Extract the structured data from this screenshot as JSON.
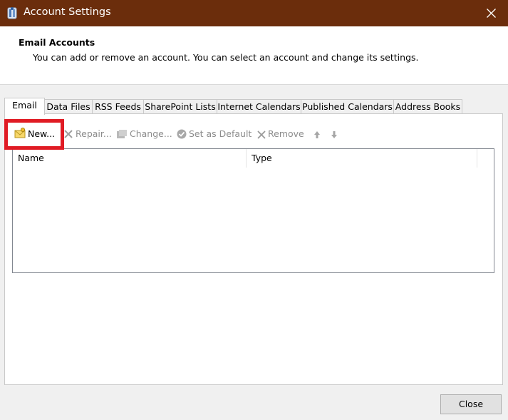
{
  "window": {
    "title": "Account Settings",
    "colors": {
      "titlebar": "#6b2d0c",
      "highlight": "#e01b24"
    },
    "title_icon": "outlook-account-icon",
    "close_icon": "close-icon"
  },
  "header": {
    "title": "Email Accounts",
    "description": "You can add or remove an account. You can select an account and change its settings."
  },
  "tabs": [
    {
      "label": "Email",
      "active": true
    },
    {
      "label": "Data Files"
    },
    {
      "label": "RSS Feeds"
    },
    {
      "label": "SharePoint Lists"
    },
    {
      "label": "Internet Calendars"
    },
    {
      "label": "Published Calendars"
    },
    {
      "label": "Address Books"
    }
  ],
  "toolbar": {
    "new_label": "New...",
    "repair_label": "Repair...",
    "change_label": "Change...",
    "set_default_label": "Set as Default",
    "remove_label": "Remove"
  },
  "list": {
    "columns": [
      "Name",
      "Type"
    ],
    "rows": []
  },
  "footer": {
    "close_label": "Close"
  }
}
